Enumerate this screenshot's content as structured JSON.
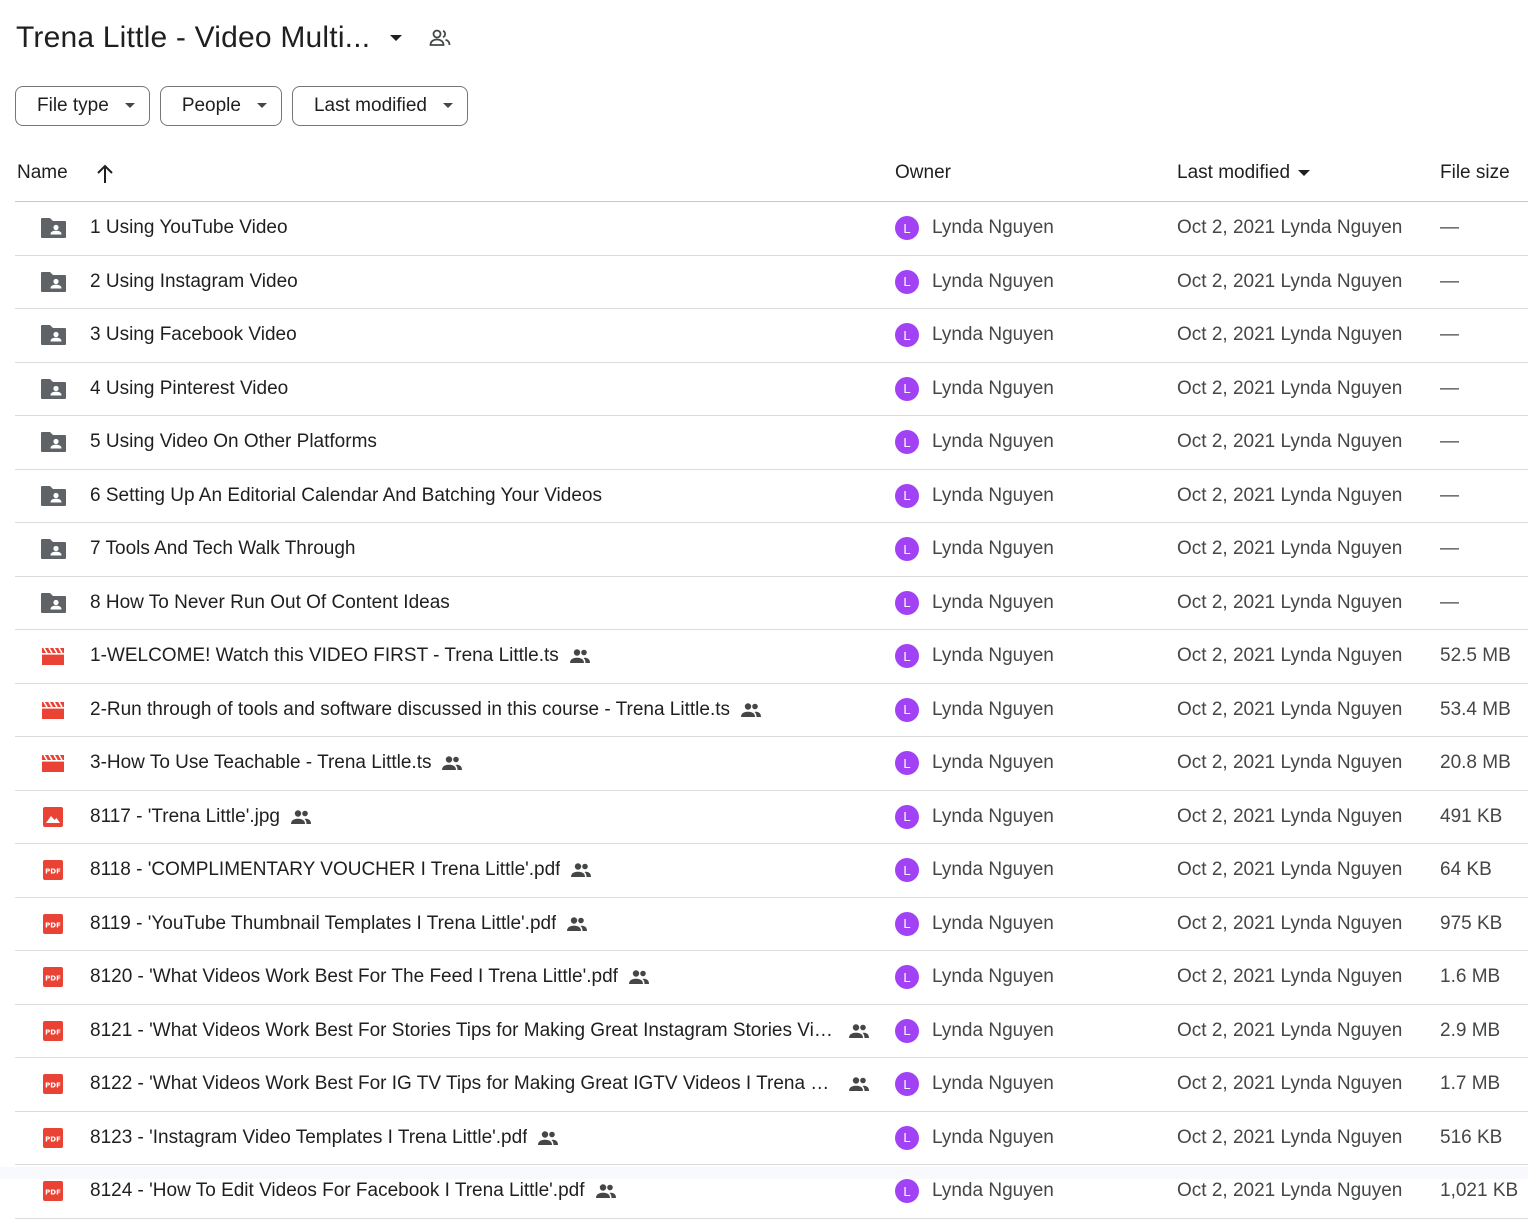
{
  "header": {
    "title": "Trena Little - Video Multi..."
  },
  "filters": [
    {
      "label": "File type"
    },
    {
      "label": "People"
    },
    {
      "label": "Last modified"
    }
  ],
  "columns": {
    "name": "Name",
    "owner": "Owner",
    "modified": "Last modified",
    "size": "File size"
  },
  "rows": [
    {
      "type": "folder",
      "name": "1 Using YouTube Video",
      "shared": false,
      "owner_initial": "L",
      "owner": "Lynda Nguyen",
      "modified": "Oct 2, 2021 Lynda Nguyen",
      "size": "—"
    },
    {
      "type": "folder",
      "name": "2 Using Instagram Video",
      "shared": false,
      "owner_initial": "L",
      "owner": "Lynda Nguyen",
      "modified": "Oct 2, 2021 Lynda Nguyen",
      "size": "—"
    },
    {
      "type": "folder",
      "name": "3 Using Facebook Video",
      "shared": false,
      "owner_initial": "L",
      "owner": "Lynda Nguyen",
      "modified": "Oct 2, 2021 Lynda Nguyen",
      "size": "—"
    },
    {
      "type": "folder",
      "name": "4 Using Pinterest Video",
      "shared": false,
      "owner_initial": "L",
      "owner": "Lynda Nguyen",
      "modified": "Oct 2, 2021 Lynda Nguyen",
      "size": "—"
    },
    {
      "type": "folder",
      "name": "5 Using Video On Other Platforms",
      "shared": false,
      "owner_initial": "L",
      "owner": "Lynda Nguyen",
      "modified": "Oct 2, 2021 Lynda Nguyen",
      "size": "—"
    },
    {
      "type": "folder",
      "name": "6 Setting Up An Editorial Calendar And Batching Your Videos",
      "shared": false,
      "owner_initial": "L",
      "owner": "Lynda Nguyen",
      "modified": "Oct 2, 2021 Lynda Nguyen",
      "size": "—"
    },
    {
      "type": "folder",
      "name": "7 Tools And Tech Walk Through",
      "shared": false,
      "owner_initial": "L",
      "owner": "Lynda Nguyen",
      "modified": "Oct 2, 2021 Lynda Nguyen",
      "size": "—"
    },
    {
      "type": "folder",
      "name": "8 How To Never Run Out Of Content Ideas",
      "shared": false,
      "owner_initial": "L",
      "owner": "Lynda Nguyen",
      "modified": "Oct 2, 2021 Lynda Nguyen",
      "size": "—"
    },
    {
      "type": "video",
      "name": "1-WELCOME! Watch this VIDEO FIRST - Trena Little.ts",
      "shared": true,
      "owner_initial": "L",
      "owner": "Lynda Nguyen",
      "modified": "Oct 2, 2021 Lynda Nguyen",
      "size": "52.5 MB"
    },
    {
      "type": "video",
      "name": "2-Run through of tools and software discussed in this course - Trena Little.ts",
      "shared": true,
      "owner_initial": "L",
      "owner": "Lynda Nguyen",
      "modified": "Oct 2, 2021 Lynda Nguyen",
      "size": "53.4 MB"
    },
    {
      "type": "video",
      "name": "3-How To Use Teachable - Trena Little.ts",
      "shared": true,
      "owner_initial": "L",
      "owner": "Lynda Nguyen",
      "modified": "Oct 2, 2021 Lynda Nguyen",
      "size": "20.8 MB"
    },
    {
      "type": "image",
      "name": "8117 - 'Trena Little'.jpg",
      "shared": true,
      "owner_initial": "L",
      "owner": "Lynda Nguyen",
      "modified": "Oct 2, 2021 Lynda Nguyen",
      "size": "491 KB"
    },
    {
      "type": "pdf",
      "name": "8118 - 'COMPLIMENTARY VOUCHER I Trena Little'.pdf",
      "shared": true,
      "owner_initial": "L",
      "owner": "Lynda Nguyen",
      "modified": "Oct 2, 2021 Lynda Nguyen",
      "size": "64 KB"
    },
    {
      "type": "pdf",
      "name": "8119 - 'YouTube Thumbnail Templates I Trena Little'.pdf",
      "shared": true,
      "owner_initial": "L",
      "owner": "Lynda Nguyen",
      "modified": "Oct 2, 2021 Lynda Nguyen",
      "size": "975 KB"
    },
    {
      "type": "pdf",
      "name": "8120 - 'What Videos Work Best For The Feed I Trena Little'.pdf",
      "shared": true,
      "owner_initial": "L",
      "owner": "Lynda Nguyen",
      "modified": "Oct 2, 2021 Lynda Nguyen",
      "size": "1.6 MB"
    },
    {
      "type": "pdf",
      "name": "8121 - 'What Videos Work Best For Stories Tips for Making Great Instagram Stories Vid...",
      "shared": true,
      "owner_initial": "L",
      "owner": "Lynda Nguyen",
      "modified": "Oct 2, 2021 Lynda Nguyen",
      "size": "2.9 MB"
    },
    {
      "type": "pdf",
      "name": "8122 - 'What Videos Work Best For IG TV Tips for Making Great IGTV Videos I Trena Li...",
      "shared": true,
      "owner_initial": "L",
      "owner": "Lynda Nguyen",
      "modified": "Oct 2, 2021 Lynda Nguyen",
      "size": "1.7 MB"
    },
    {
      "type": "pdf",
      "name": "8123 - 'Instagram Video Templates I Trena Little'.pdf",
      "shared": true,
      "owner_initial": "L",
      "owner": "Lynda Nguyen",
      "modified": "Oct 2, 2021 Lynda Nguyen",
      "size": "516 KB"
    },
    {
      "type": "pdf",
      "name": "8124 - 'How To Edit Videos For Facebook I Trena Little'.pdf",
      "shared": true,
      "owner_initial": "L",
      "owner": "Lynda Nguyen",
      "modified": "Oct 2, 2021 Lynda Nguyen",
      "size": "1,021 KB"
    }
  ]
}
